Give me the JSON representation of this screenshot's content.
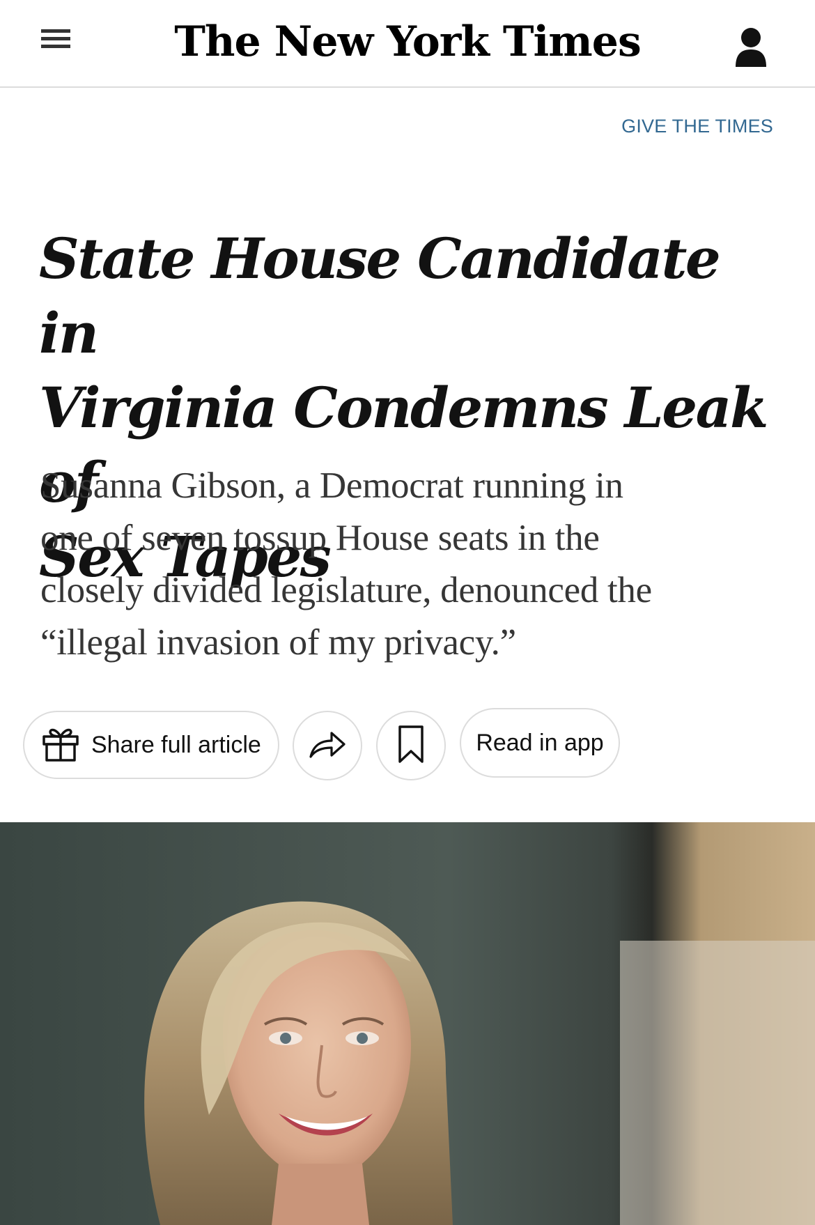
{
  "header": {
    "menu_icon": "hamburger-menu-icon",
    "masthead": "The New York Times",
    "account_icon": "person-icon"
  },
  "promo": {
    "give_times": "GIVE THE TIMES"
  },
  "article": {
    "headline_lines": [
      "State House Candidate in",
      "Virginia Condemns Leak of",
      "Sex Tapes"
    ],
    "summary_lines": [
      "Susanna Gibson, a Democrat running in",
      "one of seven tossup House seats in the",
      "closely divided legislature, denounced the",
      "“illegal invasion of my privacy.”"
    ]
  },
  "actions": {
    "share_label": "Share full article",
    "share_icon": "gift-icon",
    "forward_icon": "share-arrow-icon",
    "save_icon": "bookmark-icon",
    "read_in_app_label": "Read in app"
  },
  "colors": {
    "link_blue": "#326891",
    "text": "#121212",
    "summary_text": "#363636",
    "border": "#dcdcdc"
  }
}
